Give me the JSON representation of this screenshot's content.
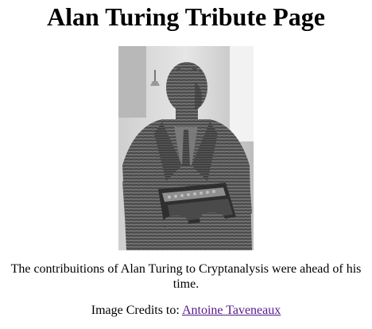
{
  "page": {
    "title": "Alan Turing Tribute Page"
  },
  "image": {
    "alt": "Slate statue of Alan Turing seated at an Enigma machine",
    "caption": "The contribuitions of Alan Turing to Cryptanalysis were ahead of his time."
  },
  "credits": {
    "prefix": "Image Credits to: ",
    "author_link": "Antoine Taveneaux"
  },
  "colors": {
    "link_visited": "#551a8b",
    "text": "#000000",
    "background": "#ffffff"
  }
}
